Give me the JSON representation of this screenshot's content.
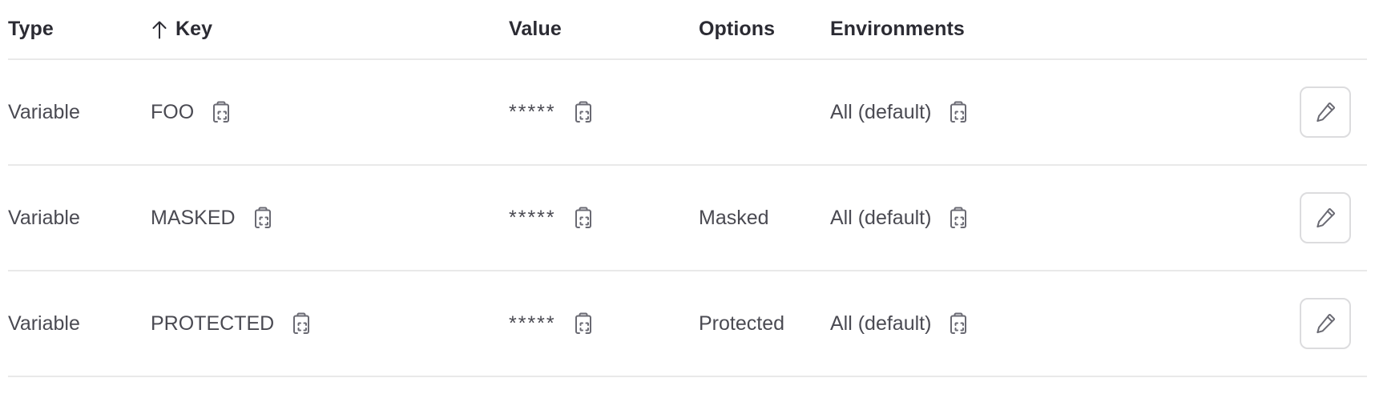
{
  "table": {
    "columns": [
      {
        "key": "type",
        "label": "Type",
        "sorted": false
      },
      {
        "key": "key",
        "label": "Key",
        "sorted": true,
        "sort_icon": "arrow-up-icon",
        "sort_direction": "asc"
      },
      {
        "key": "value",
        "label": "Value",
        "sorted": false
      },
      {
        "key": "options",
        "label": "Options",
        "sorted": false
      },
      {
        "key": "environments",
        "label": "Environments",
        "sorted": false
      }
    ],
    "rows": [
      {
        "type": "Variable",
        "key": "FOO",
        "key_copy_icon": "copy-to-clipboard-icon",
        "value": "*****",
        "value_copy_icon": "copy-to-clipboard-icon",
        "options": "",
        "environments": "All (default)",
        "environments_copy_icon": "copy-to-clipboard-icon",
        "edit_icon": "pencil-icon"
      },
      {
        "type": "Variable",
        "key": "MASKED",
        "key_copy_icon": "copy-to-clipboard-icon",
        "value": "*****",
        "value_copy_icon": "copy-to-clipboard-icon",
        "options": "Masked",
        "environments": "All (default)",
        "environments_copy_icon": "copy-to-clipboard-icon",
        "edit_icon": "pencil-icon"
      },
      {
        "type": "Variable",
        "key": "PROTECTED",
        "key_copy_icon": "copy-to-clipboard-icon",
        "value": "*****",
        "value_copy_icon": "copy-to-clipboard-icon",
        "options": "Protected",
        "environments": "All (default)",
        "environments_copy_icon": "copy-to-clipboard-icon",
        "edit_icon": "pencil-icon"
      }
    ]
  },
  "colors": {
    "text_primary": "#2b2b33",
    "text_secondary": "#4a4a52",
    "icon": "#6a6a73",
    "border": "#e9e9e9",
    "button_border": "#dcdcde",
    "background": "#ffffff"
  }
}
